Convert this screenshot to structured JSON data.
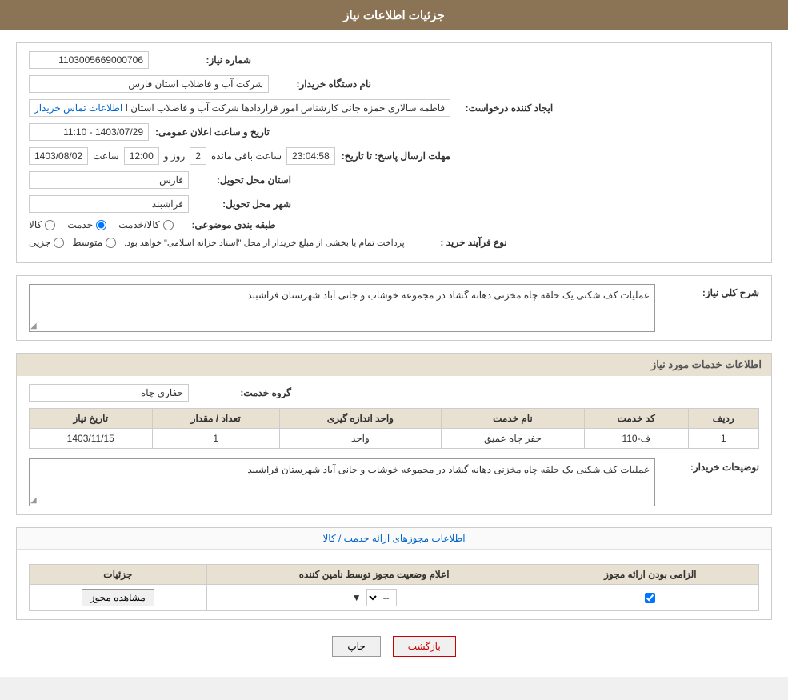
{
  "header": {
    "title": "جزئیات اطلاعات نیاز"
  },
  "fields": {
    "need_number_label": "شماره نیاز:",
    "need_number_value": "1103005669000706",
    "buyer_dept_label": "نام دستگاه خریدار:",
    "buyer_dept_value": "شرکت آب و فاضلاب استان فارس",
    "requester_label": "ایجاد کننده درخواست:",
    "requester_value": "فاطمه سالاری حمزه جانی کارشناس امور قراردادها شرکت آب و فاضلاب استان ا",
    "requester_link": "اطلاعات تماس خریدار",
    "reply_deadline_label": "مهلت ارسال پاسخ: تا تاریخ:",
    "reply_date": "1403/08/02",
    "reply_time_label": "ساعت",
    "reply_time": "12:00",
    "reply_days_label": "روز و",
    "reply_days": "2",
    "reply_remaining_label": "ساعت باقی مانده",
    "reply_remaining": "23:04:58",
    "province_label": "استان محل تحویل:",
    "province_value": "فارس",
    "city_label": "شهر محل تحویل:",
    "city_value": "فراشبند",
    "category_label": "طبقه بندی موضوعی:",
    "category_radio1": "کالا",
    "category_radio2": "خدمت",
    "category_radio3": "کالا/خدمت",
    "category_selected": "خدمت",
    "purchase_type_label": "نوع فرآیند خرید :",
    "purchase_partial": "جزیی",
    "purchase_medium": "متوسط",
    "purchase_notice": "پرداخت تمام یا بخشی از مبلغ خریدار از محل \"اسناد خزانه اسلامی\" خواهد بود.",
    "announce_datetime_label": "تاریخ و ساعت اعلان عمومی:",
    "announce_datetime": "1403/07/29 - 11:10",
    "description_label": "شرح کلی نیاز:",
    "description_value": "عملیات کف شکنی یک حلقه چاه مخزنی دهانه گشاد در مجموعه خوشاب و جانی آباد شهرستان فراشبند",
    "services_section_title": "اطلاعات خدمات مورد نیاز",
    "service_group_label": "گروه خدمت:",
    "service_group_value": "حفاری چاه",
    "table_headers": {
      "row_num": "ردیف",
      "service_code": "کد خدمت",
      "service_name": "نام خدمت",
      "unit": "واحد اندازه گیری",
      "quantity": "تعداد / مقدار",
      "date": "تاریخ نیاز"
    },
    "table_rows": [
      {
        "row_num": "1",
        "service_code": "ف-110",
        "service_name": "حفر چاه عمیق",
        "unit": "واحد",
        "quantity": "1",
        "date": "1403/11/15"
      }
    ],
    "buyer_notes_label": "توضیحات خریدار:",
    "buyer_notes_value": "عملیات کف شکنی یک حلقه چاه مخزنی دهانه گشاد در مجموعه خوشاب و جانی آباد شهرستان فراشبند",
    "license_section_title": "اطلاعات مجوزهای ارائه خدمت / کالا",
    "license_table_headers": {
      "required": "الزامی بودن ارائه مجوز",
      "status_announce": "اعلام وضعیت مجوز توسط نامین کننده",
      "details": "جزئیات"
    },
    "license_rows": [
      {
        "required": true,
        "status": "--",
        "details_btn": "مشاهده مجوز"
      }
    ],
    "buttons": {
      "print": "چاپ",
      "back": "بازگشت"
    }
  }
}
